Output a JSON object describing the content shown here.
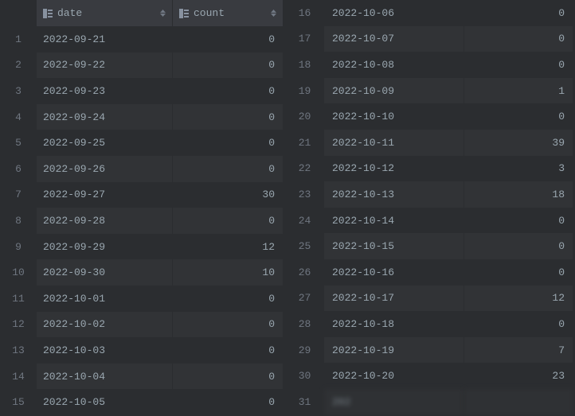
{
  "columns": {
    "date_label": "date",
    "count_label": "count"
  },
  "rows_left": [
    {
      "n": "1",
      "date": "2022-09-21",
      "count": "0"
    },
    {
      "n": "2",
      "date": "2022-09-22",
      "count": "0"
    },
    {
      "n": "3",
      "date": "2022-09-23",
      "count": "0"
    },
    {
      "n": "4",
      "date": "2022-09-24",
      "count": "0"
    },
    {
      "n": "5",
      "date": "2022-09-25",
      "count": "0"
    },
    {
      "n": "6",
      "date": "2022-09-26",
      "count": "0"
    },
    {
      "n": "7",
      "date": "2022-09-27",
      "count": "30"
    },
    {
      "n": "8",
      "date": "2022-09-28",
      "count": "0"
    },
    {
      "n": "9",
      "date": "2022-09-29",
      "count": "12"
    },
    {
      "n": "10",
      "date": "2022-09-30",
      "count": "10"
    },
    {
      "n": "11",
      "date": "2022-10-01",
      "count": "0"
    },
    {
      "n": "12",
      "date": "2022-10-02",
      "count": "0"
    },
    {
      "n": "13",
      "date": "2022-10-03",
      "count": "0"
    },
    {
      "n": "14",
      "date": "2022-10-04",
      "count": "0"
    },
    {
      "n": "15",
      "date": "2022-10-05",
      "count": "0"
    }
  ],
  "rows_right": [
    {
      "n": "16",
      "date": "2022-10-06",
      "count": "0"
    },
    {
      "n": "17",
      "date": "2022-10-07",
      "count": "0"
    },
    {
      "n": "18",
      "date": "2022-10-08",
      "count": "0"
    },
    {
      "n": "19",
      "date": "2022-10-09",
      "count": "1"
    },
    {
      "n": "20",
      "date": "2022-10-10",
      "count": "0"
    },
    {
      "n": "21",
      "date": "2022-10-11",
      "count": "39"
    },
    {
      "n": "22",
      "date": "2022-10-12",
      "count": "3"
    },
    {
      "n": "23",
      "date": "2022-10-13",
      "count": "18"
    },
    {
      "n": "24",
      "date": "2022-10-14",
      "count": "0"
    },
    {
      "n": "25",
      "date": "2022-10-15",
      "count": "0"
    },
    {
      "n": "26",
      "date": "2022-10-16",
      "count": "0"
    },
    {
      "n": "27",
      "date": "2022-10-17",
      "count": "12"
    },
    {
      "n": "28",
      "date": "2022-10-18",
      "count": "0"
    },
    {
      "n": "29",
      "date": "2022-10-19",
      "count": "7"
    },
    {
      "n": "30",
      "date": "2022-10-20",
      "count": "23"
    },
    {
      "n": "31",
      "date": "202",
      "count": "",
      "blurred": true
    }
  ]
}
